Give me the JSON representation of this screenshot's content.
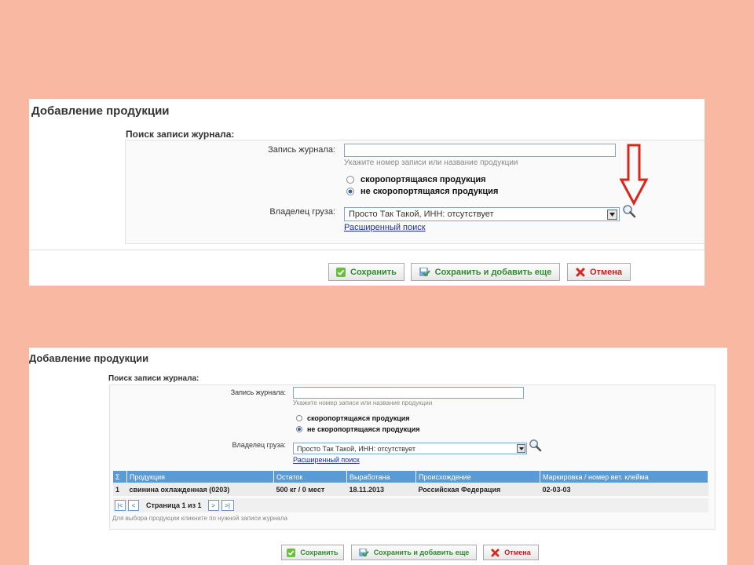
{
  "dialog1": {
    "title": "Добавление продукции",
    "section_title": "Поиск записи журнала:",
    "record_label": "Запись журнала:",
    "record_value": "",
    "record_hint": "Укажите номер записи или название продукции",
    "radio_perishable": "скоропортящаяся продукция",
    "radio_nonperishable": "не скоропортящаяся продукция",
    "selected_radio": "nonperishable",
    "owner_label": "Владелец груза:",
    "owner_value": "Просто Так Такой, ИНН: отсутствует",
    "advanced_search": "Расширенный поиск",
    "save_label": "Сохранить",
    "save_add_label": "Сохранить и добавить еще",
    "cancel_label": "Отмена"
  },
  "dialog2": {
    "title": "Добавление продукции",
    "section_title": "Поиск записи журнала:",
    "record_label": "Запись журнала:",
    "record_value": "",
    "record_hint": "Укажите номер записи или название продукции",
    "radio_perishable": "скоропортящаяся продукция",
    "radio_nonperishable": "не скоропортящаяся продукция",
    "selected_radio": "nonperishable",
    "owner_label": "Владелец груза:",
    "owner_value": "Просто Так Такой, ИНН: отсутствует",
    "advanced_search": "Расширенный поиск",
    "table": {
      "headers": [
        "Σ",
        "Продукция",
        "Остаток",
        "Выработана",
        "Происхождение",
        "Маркировка / номер вет. клейма"
      ],
      "rows": [
        [
          "1",
          "свинина охлажденная (0203)",
          "500 кг / 0 мест",
          "18.11.2013",
          "Российская Федерация",
          "02-03-03"
        ]
      ]
    },
    "pager": {
      "first": "|<",
      "prev": "<",
      "page_text": "Страница 1 из 1",
      "next": ">",
      "last": ">|"
    },
    "note": "Для выбора продукции кликните по нужной записи журнала",
    "save_label": "Сохранить",
    "save_add_label": "Сохранить и добавить еще",
    "cancel_label": "Отмена"
  },
  "colors": {
    "slide_background": "#f9b8a2",
    "annotation_arrow": "#d9261c",
    "grid_header": "#5b9bd5",
    "save_text": "#2f8a2f",
    "cancel_text": "#c81e1e",
    "link": "#1b2fa3"
  },
  "icons": {
    "save": "green-check-icon",
    "save_add": "save-add-icon",
    "cancel": "red-x-icon",
    "search": "magnifier-icon",
    "annotation": "red-down-arrow-icon"
  }
}
